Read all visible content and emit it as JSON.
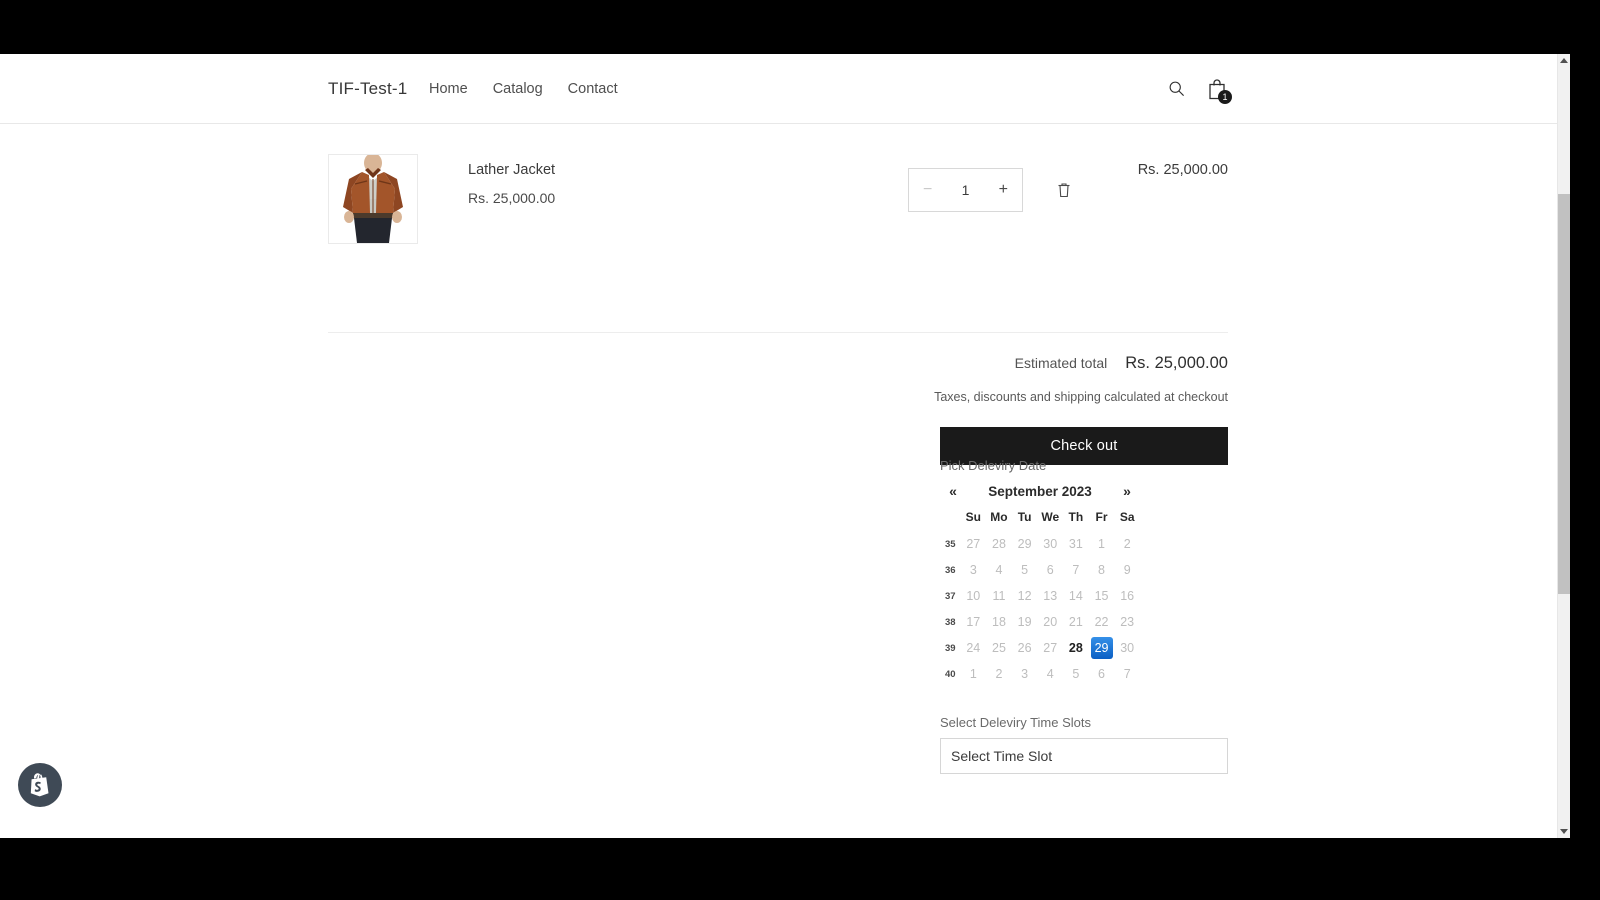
{
  "header": {
    "brand": "TIF-Test-1",
    "nav": [
      {
        "label": "Home"
      },
      {
        "label": "Catalog"
      },
      {
        "label": "Contact"
      }
    ],
    "search_icon": "search-icon",
    "cart_icon": "shopping-bag-icon",
    "cart_count": "1"
  },
  "cart": {
    "item": {
      "title": "Lather Jacket",
      "price": "Rs. 25,000.00",
      "quantity": "1",
      "minus_label": "−",
      "plus_label": "+",
      "remove_icon": "trash-icon",
      "line_price": "Rs. 25,000.00"
    }
  },
  "summary": {
    "total_label": "Estimated total",
    "total_value": "Rs. 25,000.00",
    "tax_note": "Taxes, discounts and shipping calculated at checkout",
    "checkout_label": "Check out"
  },
  "delivery": {
    "date_label": "Pick Deleviry Date",
    "calendar": {
      "prev_label": "«",
      "next_label": "»",
      "title": "September 2023",
      "weekdays": [
        "Su",
        "Mo",
        "Tu",
        "We",
        "Th",
        "Fr",
        "Sa"
      ],
      "week_numbers": [
        "35",
        "36",
        "37",
        "38",
        "39",
        "40"
      ],
      "weeks": [
        [
          "27",
          "28",
          "29",
          "30",
          "31",
          "1",
          "2"
        ],
        [
          "3",
          "4",
          "5",
          "6",
          "7",
          "8",
          "9"
        ],
        [
          "10",
          "11",
          "12",
          "13",
          "14",
          "15",
          "16"
        ],
        [
          "17",
          "18",
          "19",
          "20",
          "21",
          "22",
          "23"
        ],
        [
          "24",
          "25",
          "26",
          "27",
          "28",
          "29",
          "30"
        ],
        [
          "1",
          "2",
          "3",
          "4",
          "5",
          "6",
          "7"
        ]
      ],
      "today": {
        "week": 4,
        "day": 4,
        "value": "28"
      },
      "selected": {
        "week": 4,
        "day": 5,
        "value": "29"
      },
      "selected_color": "#1a73d4"
    },
    "timeslot_label": "Select Deleviry Time Slots",
    "timeslot_value": "Select Time Slot"
  },
  "shopify_badge": {
    "icon": "shopify-logo-icon"
  },
  "scrollbar": {
    "up_icon": "scroll-up-arrow-icon",
    "down_icon": "scroll-down-arrow-icon"
  }
}
